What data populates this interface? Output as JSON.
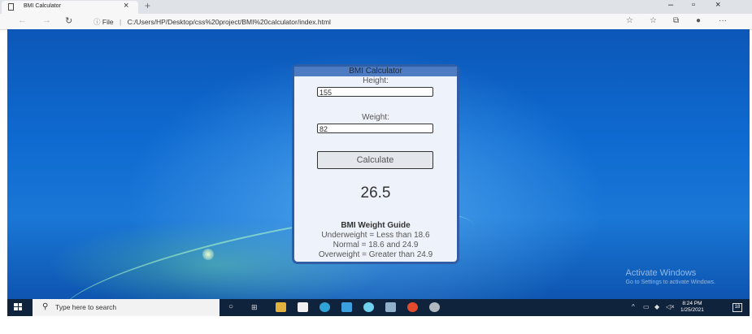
{
  "browser": {
    "tab_title": "BMI Calculator",
    "tab_close": "×",
    "new_tab": "+",
    "address_info": "ⓘ",
    "address_label": "File",
    "address_separator": "|",
    "url": "C:/Users/HP/Desktop/css%20project/BMI%20calculator/index.html",
    "window_controls": [
      "–",
      "▫",
      "×"
    ]
  },
  "calculator": {
    "title": "BMI Calculator",
    "height_label": "Height:",
    "height_value": "155",
    "weight_label": "Weight:",
    "weight_value": "82",
    "calculate_label": "Calculate",
    "result": "26.5",
    "guide_heading": "BMI Weight Guide",
    "guide_lines": [
      "Underweight = Less than 18.6",
      "Normal = 18.6 and 24.9",
      "Overweight = Greater than 24.9"
    ]
  },
  "watermark": {
    "line1": "Activate Windows",
    "line2": "Go to Settings to activate Windows."
  },
  "taskbar": {
    "search_placeholder": "Type here to search",
    "time": "8:24 PM",
    "date": "1/25/2021",
    "notification_count": "18"
  },
  "colors": {
    "card_border": "#2f5ea6",
    "card_bg": "#eef3fb",
    "taskbar_bg": "#10233d"
  }
}
